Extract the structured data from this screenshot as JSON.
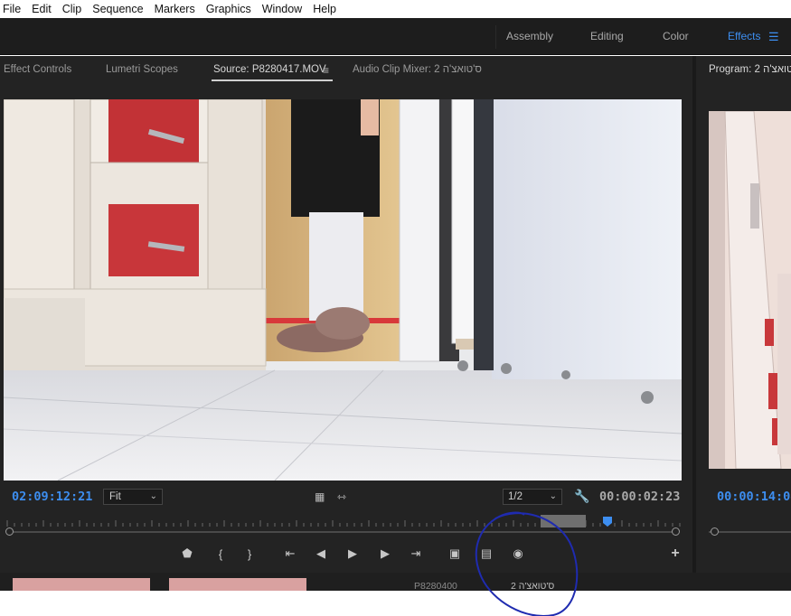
{
  "menu": [
    "File",
    "Edit",
    "Clip",
    "Sequence",
    "Markers",
    "Graphics",
    "Window",
    "Help"
  ],
  "workspaces": {
    "tabs": [
      "Assembly",
      "Editing",
      "Color",
      "Effects"
    ],
    "active": "Effects"
  },
  "source_panel": {
    "tabs": {
      "effect_controls": "Effect Controls",
      "lumetri": "Lumetri Scopes",
      "source": "Source: P8280417.MOV",
      "audio_mixer": "Audio Clip Mixer: 2 ס'טואצ'ה"
    },
    "timecode_in": "02:09:12:21",
    "zoom_select": "Fit",
    "resolution_select": "1/2",
    "timecode_duration": "00:00:02:23"
  },
  "program_panel": {
    "tab": "Program: 2 ס'טואצ'ה",
    "timecode": "00:00:14:04"
  },
  "bottom": {
    "clip_label": "P8280400",
    "sequence_label": "ס'טואצ'ה 2"
  },
  "icons": {
    "menu": "hamburger-icon",
    "wrench": "wrench-icon",
    "camera": "camera-icon"
  },
  "colors": {
    "accent": "#3d8ef0",
    "panel_bg": "#232323",
    "annotation": "#1f2bb0"
  }
}
